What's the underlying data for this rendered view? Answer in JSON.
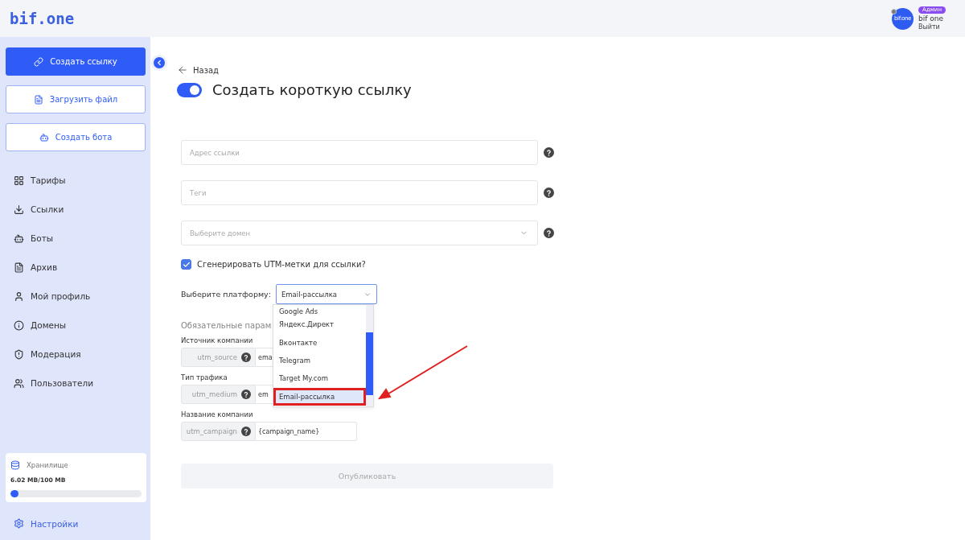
{
  "header": {
    "logo": "bif.one",
    "user": {
      "avatar_text": "bif.one",
      "role_badge": "Админ",
      "name": "bif one",
      "logout": "Выйти"
    }
  },
  "sidebar": {
    "buttons": [
      {
        "label": "Создать ссылку",
        "kind": "primary"
      },
      {
        "label": "Загрузить файл",
        "kind": "outline"
      },
      {
        "label": "Создать бота",
        "kind": "outline"
      }
    ],
    "items": [
      {
        "label": "Тарифы"
      },
      {
        "label": "Ссылки"
      },
      {
        "label": "Боты"
      },
      {
        "label": "Архив"
      },
      {
        "label": "Мой профиль"
      },
      {
        "label": "Домены"
      },
      {
        "label": "Модерация"
      },
      {
        "label": "Пользователи"
      }
    ],
    "storage": {
      "title": "Хранилище",
      "usage": "6.02 MB/100 MB",
      "level": 0.06
    },
    "settings": "Настройки"
  },
  "page": {
    "back": "Назад",
    "toggle_on": true,
    "title": "Создать короткую ссылку",
    "fields": [
      {
        "placeholder": "Адрес ссылки",
        "kind": "input"
      },
      {
        "placeholder": "Теги",
        "kind": "input"
      },
      {
        "placeholder": "Выберите домен",
        "kind": "select"
      }
    ],
    "utm_checkbox": {
      "label": "Сгенерировать UTM-метки для ссылки?",
      "checked": true
    },
    "platform": {
      "label": "Выберите платформу:",
      "value": "Email-рассылка",
      "options": [
        {
          "label": "Google Ads",
          "selected": false
        },
        {
          "label": "Яндекс.Директ",
          "selected": false
        },
        {
          "label": "Вконтакте",
          "selected": false
        },
        {
          "label": "Telegram",
          "selected": false
        },
        {
          "label": "Target My.com",
          "selected": false
        },
        {
          "label": "Email-рассылка",
          "selected": true
        }
      ]
    },
    "required_heading": "Обязательные парам",
    "utm_params": [
      {
        "label": "Источник компании",
        "key": "utm_source",
        "value": "ema"
      },
      {
        "label": "Тип трафика",
        "key": "utm_medium",
        "value": "em"
      },
      {
        "label": "Название компании",
        "key": "utm_campaign",
        "value": "{campaign_name}"
      }
    ],
    "publish": "Опубликовать"
  }
}
